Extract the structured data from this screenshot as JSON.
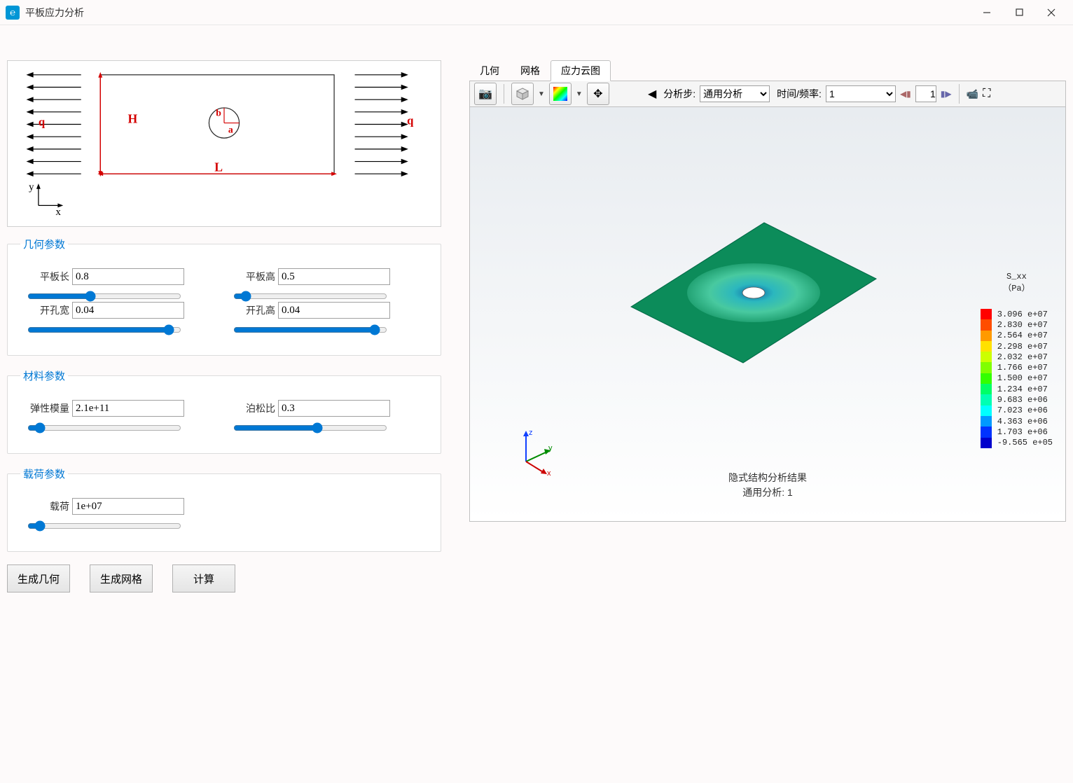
{
  "window": {
    "title": "平板应力分析"
  },
  "diagram": {
    "labels": {
      "L": "L",
      "H": "H",
      "a": "a",
      "b": "b",
      "q_left": "q",
      "q_right": "q",
      "x": "x",
      "y": "y"
    }
  },
  "params": {
    "geom": {
      "legend": "几何参数",
      "length": {
        "label": "平板长",
        "value": "0.8"
      },
      "height": {
        "label": "平板高",
        "value": "0.5"
      },
      "hole_w": {
        "label": "开孔宽",
        "value": "0.04"
      },
      "hole_h": {
        "label": "开孔高",
        "value": "0.04"
      }
    },
    "material": {
      "legend": "材料参数",
      "E": {
        "label": "弹性模量",
        "value": "2.1e+11"
      },
      "nu": {
        "label": "泊松比",
        "value": "0.3"
      }
    },
    "load": {
      "legend": "载荷参数",
      "q": {
        "label": "载荷",
        "value": "1e+07"
      }
    }
  },
  "buttons": {
    "gen_geom": "生成几何",
    "gen_mesh": "生成网格",
    "compute": "计算"
  },
  "right": {
    "tabs": {
      "geom": "几何",
      "mesh": "网格",
      "contour": "应力云图"
    },
    "toolbar": {
      "step_label": "分析步:",
      "step_select": "通用分析",
      "time_label": "时间/频率:",
      "time_select": "1",
      "frame_input": "1"
    },
    "result": {
      "title1": "隐式结构分析结果",
      "title2": "通用分析: 1",
      "triad": {
        "x": "x",
        "y": "y",
        "z": "z"
      },
      "legend": {
        "quantity": "S_xx",
        "unit": "（Pa）",
        "levels": [
          {
            "val": "3.096 e+07",
            "color": "#ff0000"
          },
          {
            "val": "2.830 e+07",
            "color": "#ff4d00"
          },
          {
            "val": "2.564 e+07",
            "color": "#ff9a00"
          },
          {
            "val": "2.298 e+07",
            "color": "#ffe100"
          },
          {
            "val": "2.032 e+07",
            "color": "#ccff00"
          },
          {
            "val": "1.766 e+07",
            "color": "#80ff00"
          },
          {
            "val": "1.500 e+07",
            "color": "#33ff00"
          },
          {
            "val": "1.234 e+07",
            "color": "#00ff66"
          },
          {
            "val": "9.683 e+06",
            "color": "#00ffb3"
          },
          {
            "val": "7.023 e+06",
            "color": "#00ffff"
          },
          {
            "val": "4.363 e+06",
            "color": "#0099ff"
          },
          {
            "val": "1.703 e+06",
            "color": "#0033ff"
          },
          {
            "val": "-9.565 e+05",
            "color": "#0000cc"
          }
        ]
      }
    }
  }
}
